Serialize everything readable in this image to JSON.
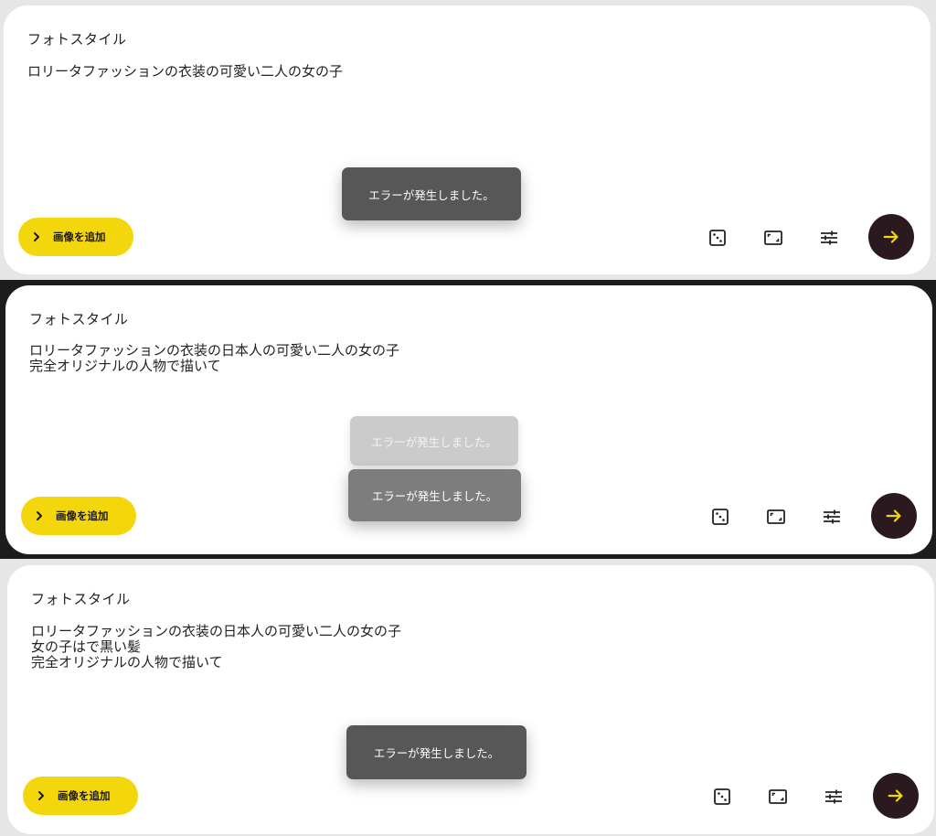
{
  "style_label": "フォトスタイル",
  "add_image_label": "画像を追加",
  "error_message": "エラーが発生しました。",
  "accent_color": "#f4d60c",
  "send_button_color": "#2a1a20",
  "icons": [
    "chevron-right-icon",
    "dice-icon",
    "aspect-ratio-icon",
    "sliders-icon",
    "arrow-right-icon"
  ],
  "panels": [
    {
      "prompt_lines": [
        "ロリータファッションの衣装の可愛い二人の女の子"
      ]
    },
    {
      "prompt_lines": [
        "ロリータファッションの衣装の日本人の可愛い二人の女の子",
        "完全オリジナルの人物で描いて"
      ]
    },
    {
      "prompt_lines": [
        "ロリータファッションの衣装の日本人の可愛い二人の女の子",
        "女の子はで黒い髪",
        "完全オリジナルの人物で描いて"
      ]
    }
  ]
}
